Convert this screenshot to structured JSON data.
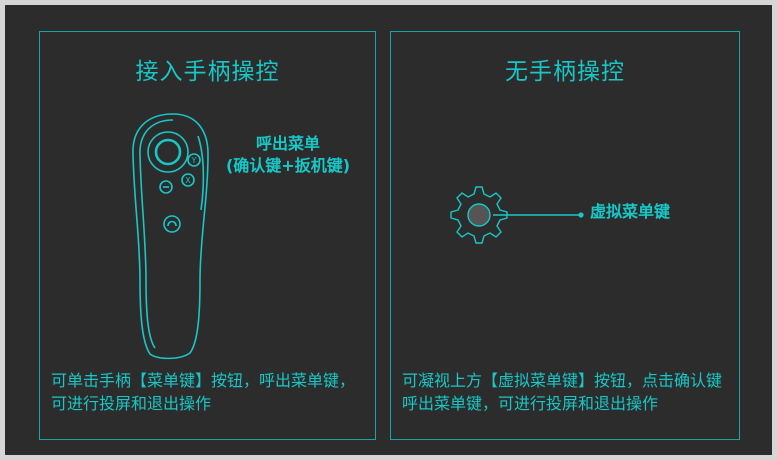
{
  "left_panel": {
    "title": "接入手柄操控",
    "callout_line1": "呼出菜单",
    "callout_line2": "(确认键+扳机键)",
    "description": "可单击手柄【菜单键】按钮，呼出菜单键，可进行投屏和退出操作"
  },
  "right_panel": {
    "title": "无手柄操控",
    "callout": "虚拟菜单键",
    "description": "可凝视上方【虚拟菜单键】按钮，点击确认键呼出菜单键，可进行投屏和退出操作"
  },
  "colors": {
    "accent": "#18c7c7",
    "background": "#2c2c2c",
    "border": "#1aa5a5"
  }
}
